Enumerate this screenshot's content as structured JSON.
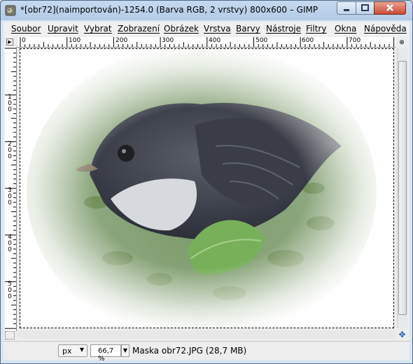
{
  "window": {
    "title": "*[obr72](naimportován)-1254.0 (Barva RGB, 2 vrstvy) 800x600 – GIMP"
  },
  "menubar": {
    "items": [
      {
        "label": "Soubor"
      },
      {
        "label": "Upravit"
      },
      {
        "label": "Vybrat"
      },
      {
        "label": "Zobrazení"
      },
      {
        "label": "Obrázek"
      },
      {
        "label": "Vrstva"
      },
      {
        "label": "Barvy"
      },
      {
        "label": "Nástroje"
      },
      {
        "label": "Filtry"
      },
      {
        "label": "Okna"
      },
      {
        "label": "Nápověda"
      }
    ]
  },
  "rulers": {
    "horizontal": [
      "0",
      "100",
      "200",
      "300",
      "400",
      "500",
      "600",
      "700"
    ],
    "vertical": [
      "1\n0\n0",
      "2\n0\n0",
      "3\n0\n0",
      "4\n0\n0",
      "5\n0\n0"
    ]
  },
  "statusbar": {
    "unit": "px",
    "unit_arrow": "▼",
    "zoom": "66,7 %",
    "zoom_arrow": "▼",
    "message": "Maska obr72.JPG (28,7 MB)"
  },
  "icons": {
    "navigate": "✥"
  },
  "colors": {
    "titlebar": "#c6d9ef",
    "close_button": "#c74b36"
  }
}
